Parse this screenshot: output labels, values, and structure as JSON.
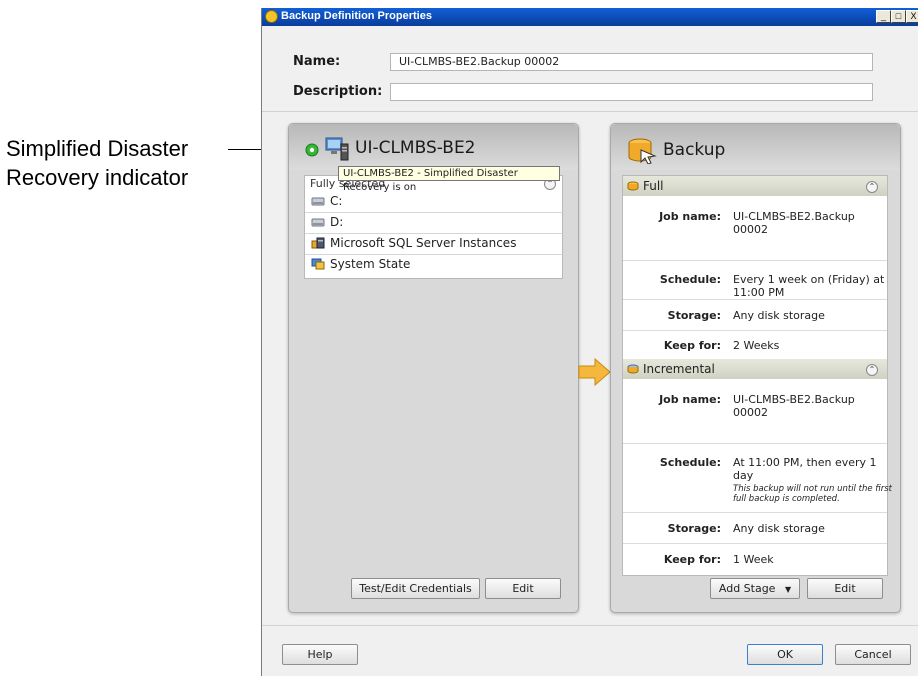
{
  "callout": {
    "line1": "Simplified Disaster",
    "line2": "Recovery indicator"
  },
  "window": {
    "title": "Backup Definition Properties",
    "min": "_",
    "max": "□",
    "close": "X"
  },
  "form": {
    "name_label": "Name:",
    "name_value": "UI-CLMBS-BE2.Backup 00002",
    "description_label": "Description:",
    "description_value": ""
  },
  "source": {
    "server_name": "UI-CLMBS-BE2",
    "tooltip": "UI-CLMBS-BE2 - Simplified Disaster Recovery is on",
    "selection_label": "Fully selected",
    "items": [
      {
        "label": "C:",
        "icon": "drive-icon"
      },
      {
        "label": "D:",
        "icon": "drive-icon"
      },
      {
        "label": "Microsoft SQL Server Instances",
        "icon": "sql-server-icon"
      },
      {
        "label": "System State",
        "icon": "system-state-icon"
      }
    ],
    "test_credentials_label": "Test/Edit Credentials",
    "edit_label": "Edit"
  },
  "backup": {
    "title": "Backup",
    "stages": [
      {
        "name": "Full",
        "job_name_label": "Job name:",
        "job_name": "UI-CLMBS-BE2.Backup 00002",
        "schedule_label": "Schedule:",
        "schedule": "Every 1 week on (Friday) at 11:00 PM",
        "schedule_note": "",
        "storage_label": "Storage:",
        "storage": "Any disk storage",
        "keep_label": "Keep for:",
        "keep": "2 Weeks"
      },
      {
        "name": "Incremental",
        "job_name_label": "Job name:",
        "job_name": "UI-CLMBS-BE2.Backup 00002",
        "schedule_label": "Schedule:",
        "schedule": "At 11:00 PM, then every 1 day",
        "schedule_note": "This backup will not run until the first full backup is completed.",
        "storage_label": "Storage:",
        "storage": "Any disk storage",
        "keep_label": "Keep for:",
        "keep": "1 Week"
      }
    ],
    "add_stage_label": "Add Stage",
    "edit_label": "Edit"
  },
  "footer": {
    "help_label": "Help",
    "ok_label": "OK",
    "cancel_label": "Cancel"
  },
  "colors": {
    "title_bar": "#0a4fc4",
    "accent_ok": "#3b7fd1",
    "indicator_green": "#35b534",
    "arrow_orange": "#f5b73c"
  }
}
